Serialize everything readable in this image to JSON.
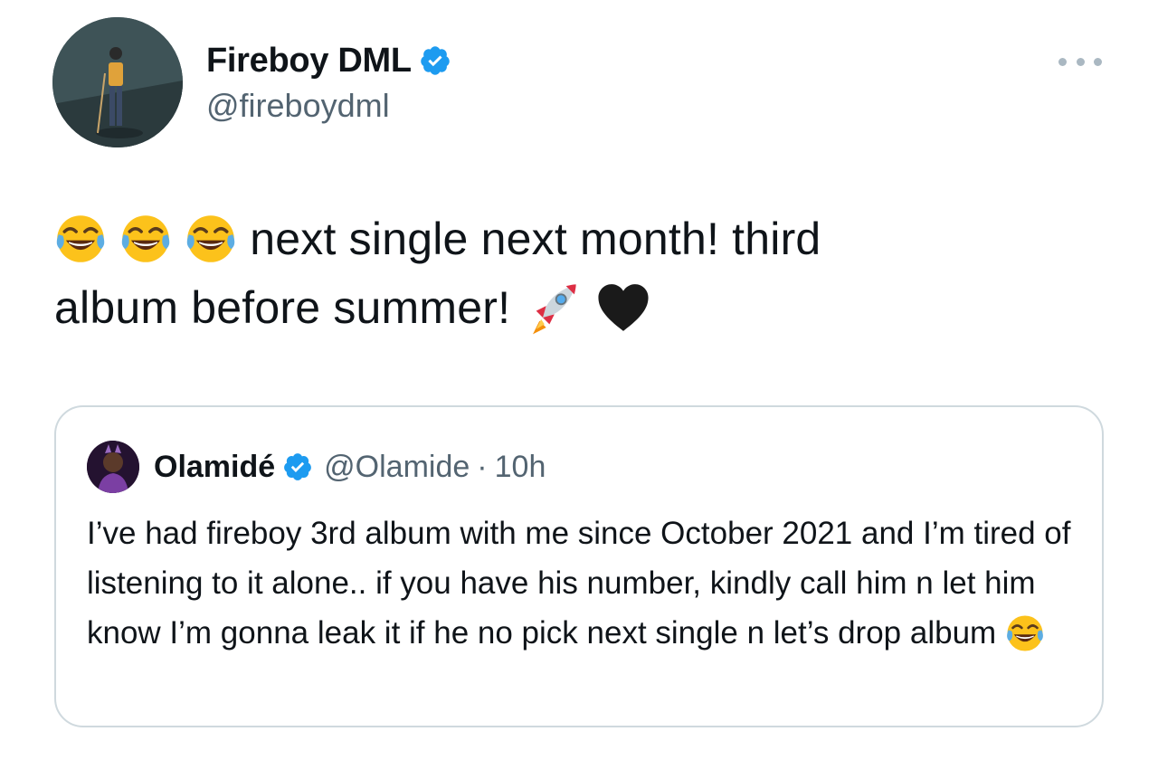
{
  "author": {
    "name": "Fireboy DML",
    "handle": "@fireboydml",
    "verified": true,
    "avatar_icon": "avatar-fireboy"
  },
  "more_icon": "more-horizontal-icon",
  "tweet": {
    "text_line1": "next single next month! third",
    "text_line2": "album before summer!",
    "emojis_leading": [
      "joy-emoji",
      "joy-emoji",
      "joy-emoji"
    ],
    "emojis_trailing": [
      "rocket-emoji",
      "black-heart-emoji"
    ]
  },
  "quoted_tweet": {
    "name": "Olamidé",
    "handle": "@Olamide",
    "separator": "·",
    "time": "10h",
    "verified": true,
    "avatar_icon": "avatar-olamide",
    "text": "I’ve had fireboy 3rd album with me since October 2021 and I’m tired of listening to it alone.. if you have his number, kindly call him n let him know I’m gonna leak it if he no pick next single n let’s drop album",
    "trailing_emoji": "joy-emoji"
  },
  "colors": {
    "verified_blue": "#1d9bf0",
    "secondary_text": "#536471",
    "border": "#cfd9de",
    "primary_text": "#0f1419"
  }
}
